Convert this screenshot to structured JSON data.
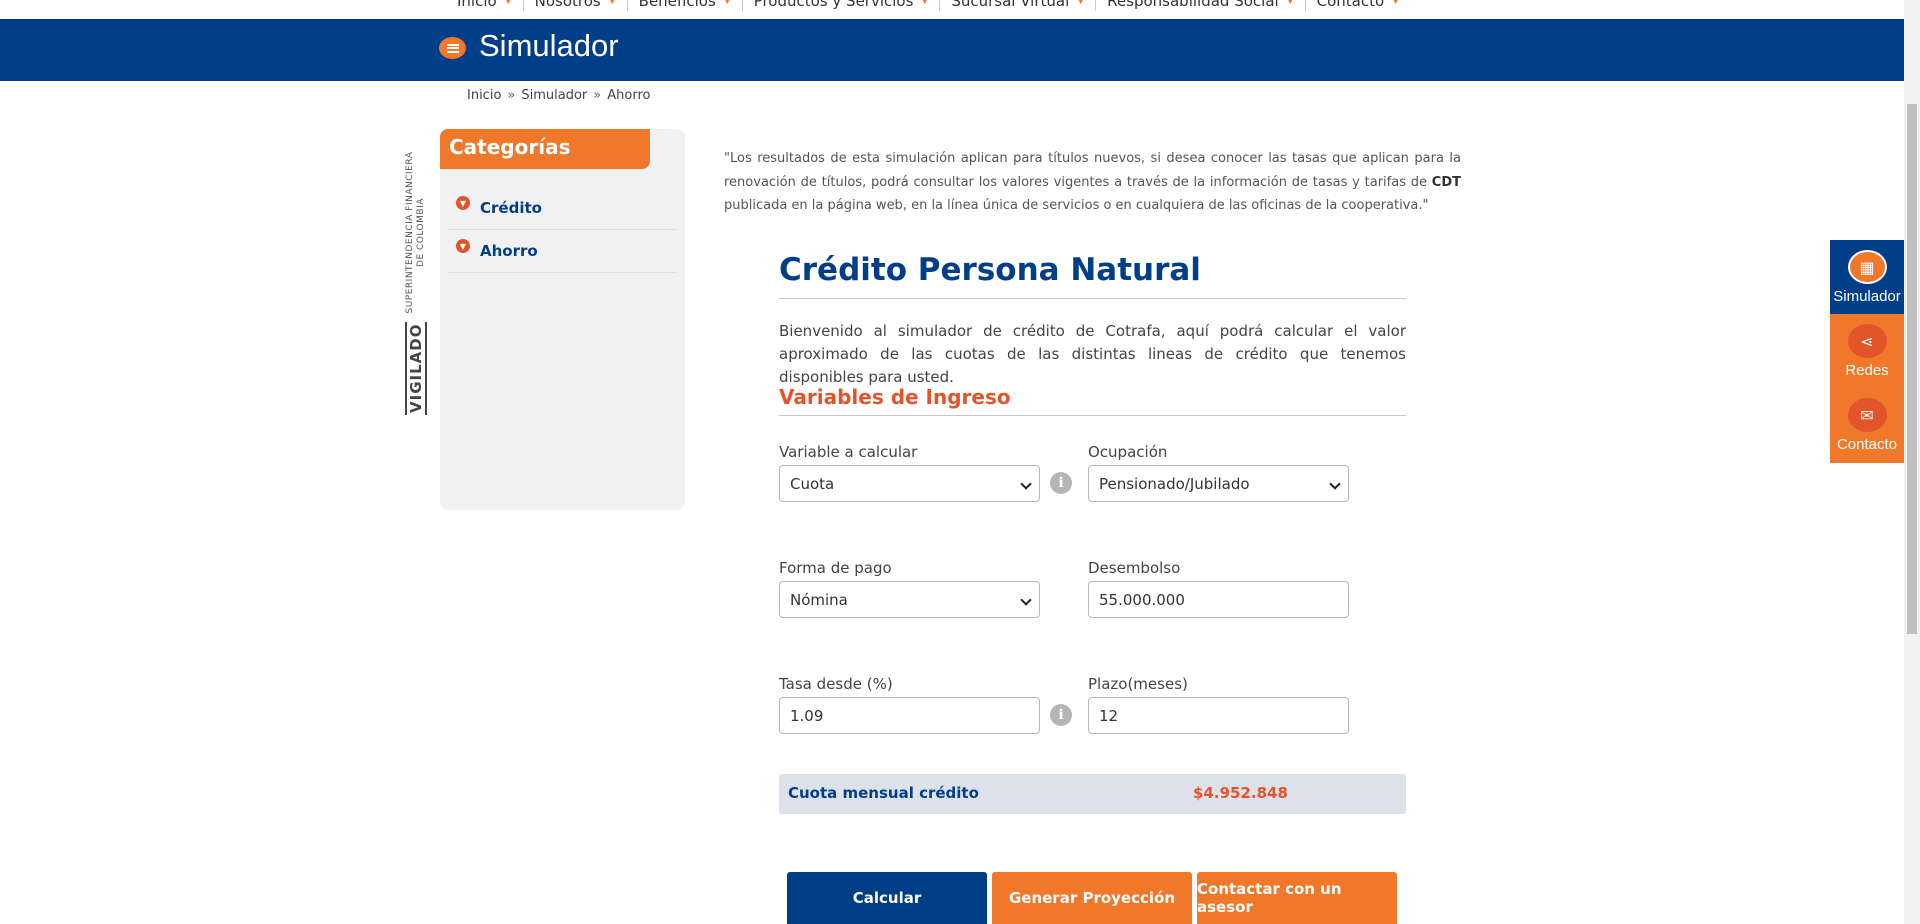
{
  "nav": {
    "items": [
      "Inicio",
      "Nosotros",
      "Beneficios",
      "Productos y Servicios",
      "Sucursal Virtual",
      "Responsabilidad Social",
      "Contacto"
    ]
  },
  "header": {
    "title": "Simulador",
    "icon": "list-icon"
  },
  "breadcrumb": {
    "items": [
      "Inicio",
      "Simulador",
      "Ahorro"
    ],
    "separator": "»"
  },
  "vigilado": {
    "main": "VIGILADO",
    "sub": "SUPERINTENDENCIA FINANCIERA DE COLOMBIA"
  },
  "sidebar": {
    "title": "Categorías",
    "items": [
      {
        "label": "Crédito",
        "icon": "chevron-down-icon"
      },
      {
        "label": "Ahorro",
        "icon": "chevron-down-icon"
      }
    ]
  },
  "disclaimer": {
    "part1": "\"Los resultados de esta simulación aplican para títulos nuevos, si desea conocer las tasas que aplican para la renovación de títulos, podrá consultar los valores vigentes a través de la información de tasas y tarifas de ",
    "bold": "CDT",
    "part2": " publicada en la página web, en la línea única de servicios o en cualquiera de las oficinas de la cooperativa.\""
  },
  "main": {
    "title": "Crédito Persona Natural",
    "intro": "Bienvenido al simulador de crédito de Cotrafa, aquí podrá calcular el valor aproximado de las cuotas de las distintas lineas de crédito que tenemos disponibles para usted.",
    "subtitle": "Variables de Ingreso"
  },
  "form": {
    "variable": {
      "label": "Variable a calcular",
      "value": "Cuota"
    },
    "ocupacion": {
      "label": "Ocupación",
      "value": "Pensionado/Jubilado"
    },
    "forma_pago": {
      "label": "Forma de pago",
      "value": "Nómina"
    },
    "desembolso": {
      "label": "Desembolso",
      "value": "55.000.000"
    },
    "tasa": {
      "label": "Tasa desde (%)",
      "value": "1.09"
    },
    "plazo": {
      "label": "Plazo(meses)",
      "value": "12"
    },
    "info_symbol": "i"
  },
  "result": {
    "label": "Cuota mensual crédito",
    "value": "$4.952.848"
  },
  "buttons": {
    "calcular": "Calcular",
    "proyeccion": "Generar Proyección",
    "asesor": "Contactar con un asesor"
  },
  "floating": {
    "items": [
      {
        "label": "Simulador",
        "icon": "calculator-icon"
      },
      {
        "label": "Redes",
        "icon": "share-icon"
      },
      {
        "label": "Contacto",
        "icon": "mail-icon"
      }
    ]
  },
  "colors": {
    "brand_blue": "#003f88",
    "brand_orange": "#f0782a",
    "accent_red": "#e2552b"
  }
}
